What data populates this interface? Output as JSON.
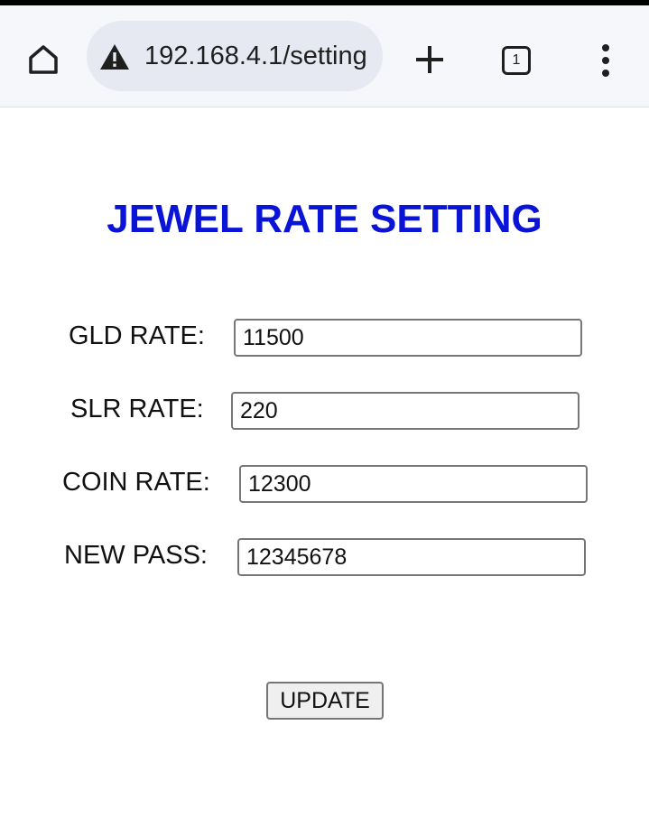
{
  "browser": {
    "url": "192.168.4.1/setting",
    "tab_count": "1",
    "icons": [
      "home-icon",
      "warning-icon",
      "plus-icon",
      "tabs-icon",
      "more-vert-icon"
    ]
  },
  "page": {
    "title": "JEWEL RATE SETTING",
    "title_color": "#0a14d6",
    "fields": [
      {
        "label": "GLD RATE:",
        "value": "11500"
      },
      {
        "label": "SLR RATE:",
        "value": "220"
      },
      {
        "label": "COIN RATE:",
        "value": "12300"
      },
      {
        "label": "NEW PASS:",
        "value": "12345678"
      }
    ],
    "submit_label": "UPDATE"
  }
}
